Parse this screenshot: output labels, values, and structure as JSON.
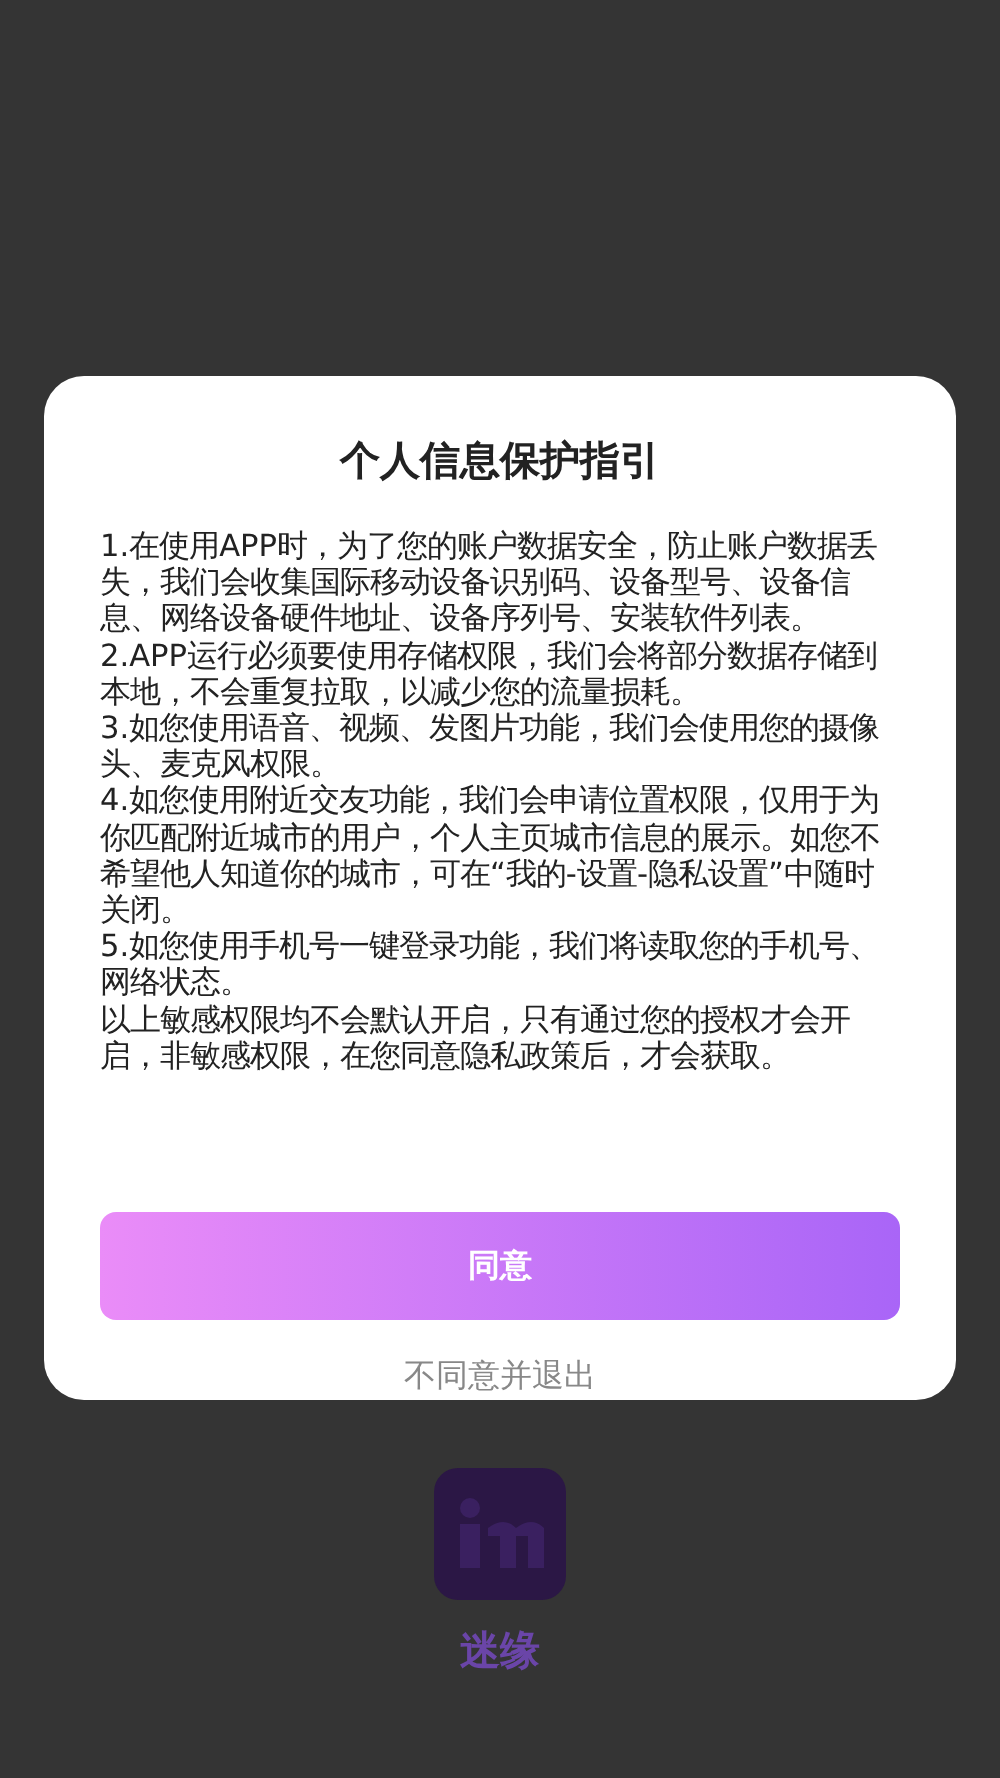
{
  "dialog": {
    "title": "个人信息保护指引",
    "paragraphs": [
      "1.在使用APP时，为了您的账户数据安全，防止账户数据丢失，我们会收集国际移动设备识别码、设备型号、设备信息、网络设备硬件地址、设备序列号、安装软件列表。",
      "2.APP运行必须要使用存储权限，我们会将部分数据存储到本地，不会重复拉取，以减少您的流量损耗。",
      "3.如您使用语音、视频、发图片功能，我们会使用您的摄像头、麦克风权限。",
      "4.如您使用附近交友功能，我们会申请位置权限，仅用于为你匹配附近城市的用户，个人主页城市信息的展示。如您不希望他人知道你的城市，可在“我的-设置-隐私设置”中随时关闭。",
      "5.如您使用手机号一键登录功能，我们将读取您的手机号、网络状态。",
      "以上敏感权限均不会默认开启，只有通过您的授权才会开启，非敏感权限，在您同意隐私政策后，才会获取。"
    ],
    "agree_button": "同意",
    "decline_link": "不同意并退出"
  },
  "app": {
    "name": "迷缘"
  }
}
